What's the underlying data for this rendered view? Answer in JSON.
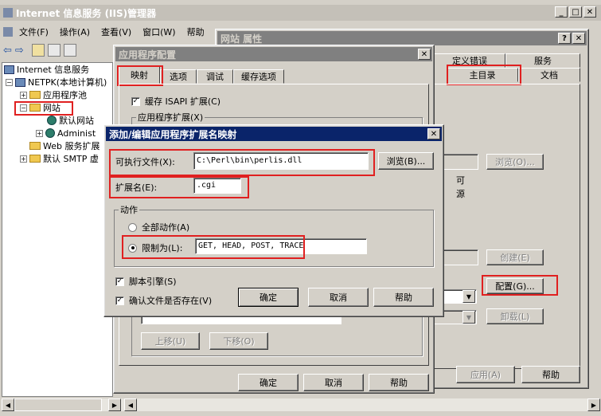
{
  "main_window": {
    "title": "Internet 信息服务 (IIS)管理器",
    "menu": [
      "文件(F)",
      "操作(A)",
      "查看(V)",
      "窗口(W)",
      "帮助"
    ],
    "tree": {
      "root": "Internet 信息服务",
      "server": "NETPK(本地计算机)",
      "app_pools": "应用程序池",
      "websites": "网站",
      "default_site": "默认网站",
      "admin_site": "Administ",
      "web_ext": "Web 服务扩展",
      "smtp": "默认 SMTP 虚"
    }
  },
  "site_props": {
    "title": "网站 属性",
    "tabs_row1": [
      "定义错误",
      "服务"
    ],
    "tabs_row2": [
      "主目录",
      "文档"
    ],
    "browse_label": "浏览(O)...",
    "readable_fragment": "可",
    "log_fragment": "源",
    "create_label": "创建(E)",
    "config_label": "配置(G)...",
    "unload_label": "卸载(L)",
    "apply_label": "应用(A)",
    "help_label": "帮助"
  },
  "app_config": {
    "title": "应用程序配置",
    "tabs": [
      "映射",
      "选项",
      "调试",
      "缓存选项"
    ],
    "cache_isapi": "缓存 ISAPI 扩展(C)",
    "app_ext_label": "应用程序扩展(X)",
    "move_up": "上移(U)",
    "move_down": "下移(O)",
    "ok": "确定",
    "cancel": "取消",
    "help": "帮助"
  },
  "ext_dialog": {
    "title": "添加/编辑应用程序扩展名映射",
    "exe_label": "可执行文件(X):",
    "exe_value": "C:\\Perl\\bin\\perlis.dll",
    "browse": "浏览(B)...",
    "ext_label": "扩展名(E):",
    "ext_value": ".cgi",
    "action_group": "动作",
    "all_verbs": "全部动作(A)",
    "limit_to": "限制为(L):",
    "limit_value": "GET, HEAD, POST, TRACE",
    "script_engine": "脚本引擎(S)",
    "verify_file": "确认文件是否存在(V)",
    "ok": "确定",
    "cancel": "取消",
    "help": "帮助"
  },
  "colors": {
    "active_title": "#0a246a",
    "highlight_box": "#e02020"
  }
}
